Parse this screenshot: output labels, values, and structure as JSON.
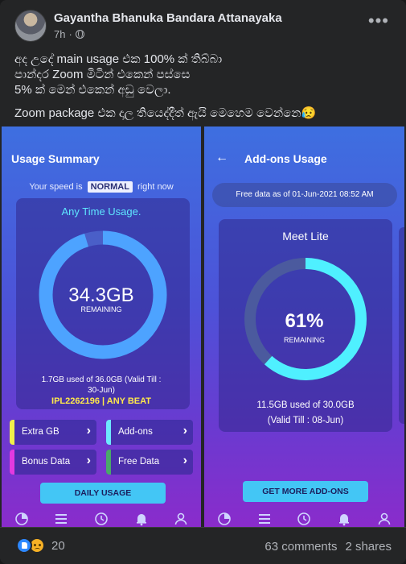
{
  "post": {
    "author": "Gayantha Bhanuka Bandara Attanayaka",
    "time": "7h",
    "separator": "·",
    "more_icon": "more-horizontal-icon",
    "lines": [
      "අද උදේ main usage එක 100% ක් තිබ්බා",
      "පාන්දර Zoom මිටින් එකෙන් පස්සෙ",
      "5% ක් මෙන් එකෙන් අඩු වෙලා."
    ],
    "line_last": "Zoom package එක දාල තියෙද්දීත් ඇයි මෙහෙම වෙන්නෙ😥"
  },
  "left_screen": {
    "title": "Usage Summary",
    "speed_prefix": "Your speed is",
    "speed_value": "NORMAL",
    "speed_suffix": "right now",
    "any_time_label": "Any Time Usage.",
    "remaining_value": "34.3GB",
    "remaining_label": "REMAINING",
    "remaining_fraction": 0.953,
    "usage_line1": "1.7GB used of 36.0GB (Valid Till :",
    "usage_line2": "30-Jun)",
    "account": "IPL2262196 | ANY BEAT",
    "tiles": [
      {
        "label": "Extra GB",
        "color": "#f0f04a"
      },
      {
        "label": "Add-ons",
        "color": "#6ee7ff"
      },
      {
        "label": "Bonus Data",
        "color": "#e23ae0"
      },
      {
        "label": "Free Data",
        "color": "#4aa86a"
      }
    ],
    "cta": "DAILY USAGE"
  },
  "right_screen": {
    "title": "Add-ons Usage",
    "free_data": "Free data as of 01-Jun-2021 08:52 AM",
    "card_title": "Meet Lite",
    "percent": "61%",
    "remaining_label": "REMAINING",
    "remaining_fraction": 0.617,
    "usage_line1": "11.5GB used of 30.0GB",
    "usage_line2": "(Valid Till : 08-Jun)",
    "cta": "GET MORE ADD-ONS"
  },
  "bottom_nav_icons": [
    "pie-chart-icon",
    "list-icon",
    "history-icon",
    "bell-icon",
    "user-icon"
  ],
  "footer": {
    "reaction_count": "20",
    "comments": "63 comments",
    "shares": "2 shares"
  },
  "colors": {
    "ring_left": "#4da3ff",
    "ring_track": "#4a5fc8",
    "ring_right": "#4ff0ff",
    "ring_right_track": "#4b5a9e"
  }
}
